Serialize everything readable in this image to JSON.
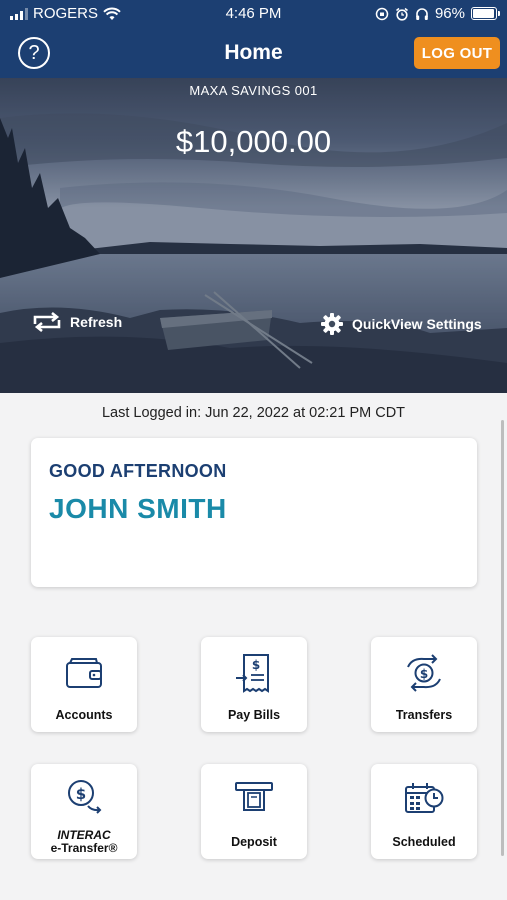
{
  "status_bar": {
    "carrier": "ROGERS",
    "time": "4:46 PM",
    "battery": "96%",
    "battery_level": 0.96
  },
  "header": {
    "title": "Home",
    "help_label": "?",
    "logout_label": "LOG OUT"
  },
  "hero": {
    "account_name": "MAXA SAVINGS 001",
    "balance": "$10,000.00",
    "refresh_label": "Refresh",
    "quickview_label": "QuickView Settings"
  },
  "last_logged": "Last Logged in: Jun 22, 2022 at 02:21 PM  CDT",
  "greeting": {
    "line": "GOOD AFTERNOON",
    "name": "JOHN SMITH"
  },
  "tiles": [
    {
      "label": "Accounts",
      "icon": "wallet-icon"
    },
    {
      "label": "Pay Bills",
      "icon": "bill-icon"
    },
    {
      "label": "Transfers",
      "icon": "transfer-icon"
    },
    {
      "label_line1": "INTERAC",
      "label_line2": "e-Transfer®",
      "icon": "etransfer-icon"
    },
    {
      "label": "Deposit",
      "icon": "atm-deposit-icon"
    },
    {
      "label": "Scheduled",
      "icon": "calendar-clock-icon"
    }
  ],
  "colors": {
    "header_bg": "#1c3f72",
    "logout_bg": "#ef8f1f",
    "name_accent": "#1a8aa8"
  }
}
